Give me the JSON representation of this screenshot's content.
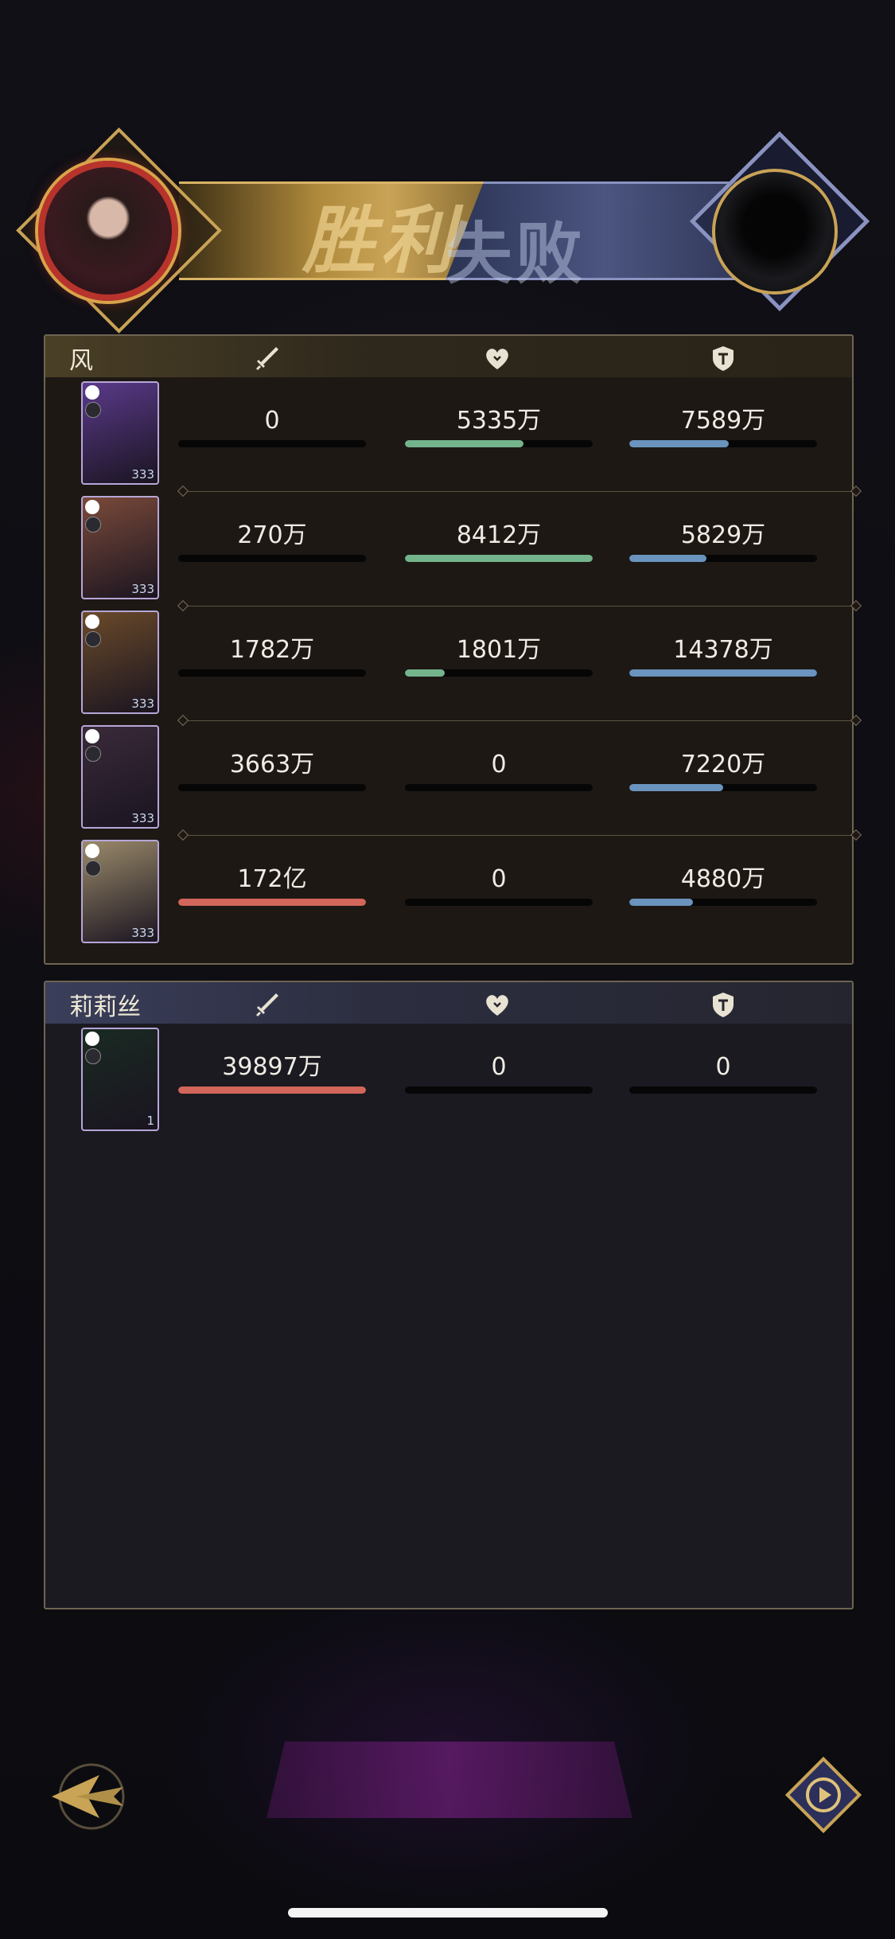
{
  "banner": {
    "victory": "胜利",
    "defeat": "失败"
  },
  "team_a": {
    "name": "风",
    "rows": [
      {
        "level": "333",
        "attack": "0",
        "heal": "5335万",
        "defense": "7589万",
        "attack_fill": 0,
        "heal_fill": 0.63,
        "defense_fill": 0.53,
        "card_color": "#5a3a8a"
      },
      {
        "level": "333",
        "attack": "270万",
        "heal": "8412万",
        "defense": "5829万",
        "attack_fill": 0,
        "heal_fill": 1.0,
        "defense_fill": 0.41,
        "card_color": "#7a4a3a"
      },
      {
        "level": "333",
        "attack": "1782万",
        "heal": "1801万",
        "defense": "14378万",
        "attack_fill": 0,
        "heal_fill": 0.21,
        "defense_fill": 1.0,
        "card_color": "#6a4a2a"
      },
      {
        "level": "333",
        "attack": "3663万",
        "heal": "0",
        "defense": "7220万",
        "attack_fill": 0,
        "heal_fill": 0,
        "defense_fill": 0.5,
        "card_color": "#3a2a3a"
      },
      {
        "level": "333",
        "attack": "172亿",
        "heal": "0",
        "defense": "4880万",
        "attack_fill": 1.0,
        "heal_fill": 0,
        "defense_fill": 0.34,
        "card_color": "#9a8a6a"
      }
    ]
  },
  "team_b": {
    "name": "莉莉丝",
    "rows": [
      {
        "level": "1",
        "attack": "39897万",
        "heal": "0",
        "defense": "0",
        "attack_fill": 1.0,
        "heal_fill": 0,
        "defense_fill": 0,
        "card_color": "#1a2a22"
      }
    ]
  },
  "colors": {
    "attack": "#d2665a",
    "heal": "#73b48c",
    "defense": "#6a94be",
    "gold": "#c9a356"
  }
}
